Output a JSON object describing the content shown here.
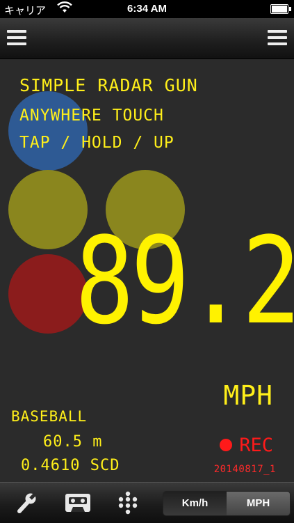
{
  "status": {
    "carrier": "キャリア",
    "time": "6:34 AM"
  },
  "main": {
    "title": "SIMPLE RADAR GUN",
    "hint_line1": "ANYWHERE TOUCH",
    "hint_line2": "TAP / HOLD / UP",
    "speed": "89.2",
    "unit": "MPH",
    "sport": "BASEBALL",
    "distance": "60.5 m",
    "elapsed": "0.4610 SCD",
    "rec_label": "REC",
    "rec_file": "20140817_1"
  },
  "toolbar": {
    "icons": [
      "wrench-icon",
      "cassette-icon",
      "grid-icon"
    ],
    "unit_options": [
      "Km/h",
      "MPH"
    ],
    "selected_unit": "MPH"
  },
  "colors": {
    "display": "#fff200",
    "rec": "#ff1a1a",
    "circle_blue": "#2f5fa0",
    "circle_olive": "#8a861e",
    "circle_red": "#8b1c1c"
  }
}
